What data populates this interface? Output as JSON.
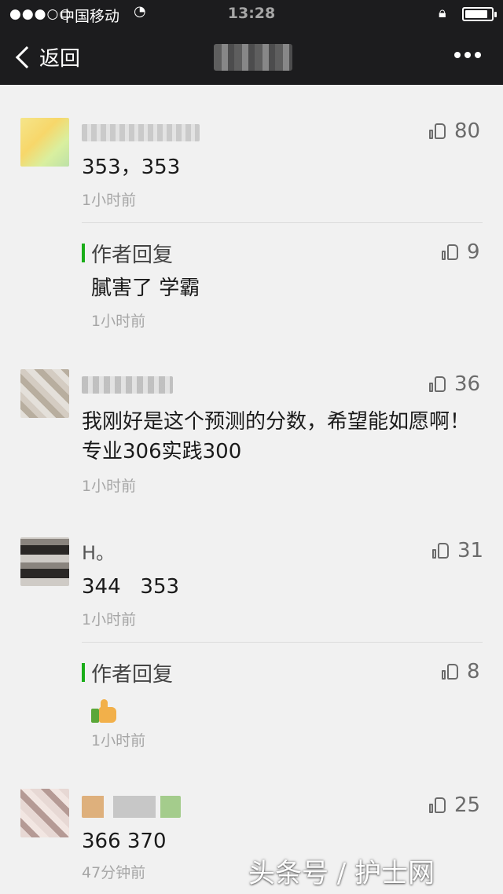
{
  "status_bar": {
    "signal": "●●●○○",
    "carrier": "中国移动",
    "time": "13:28"
  },
  "nav": {
    "back_label": "返回"
  },
  "comments": [
    {
      "name": "",
      "text": "353，353",
      "time": "1小时前",
      "likes": "80",
      "reply": {
        "label": "作者回复",
        "text": "膩害了 学霸",
        "time": "1小时前",
        "likes": "9"
      }
    },
    {
      "name": "",
      "text": "我刚好是这个预测的分数，希望能如愿啊！专业306实践300",
      "time": "1小时前",
      "likes": "36"
    },
    {
      "name": "H。",
      "text": "344   353",
      "time": "1小时前",
      "likes": "31",
      "reply": {
        "label": "作者回复",
        "text": "",
        "time": "1小时前",
        "likes": "8"
      }
    },
    {
      "name": "",
      "text": "366 370",
      "time": "47分钟前",
      "likes": "25"
    }
  ],
  "watermark": "头条号 / 护士网"
}
